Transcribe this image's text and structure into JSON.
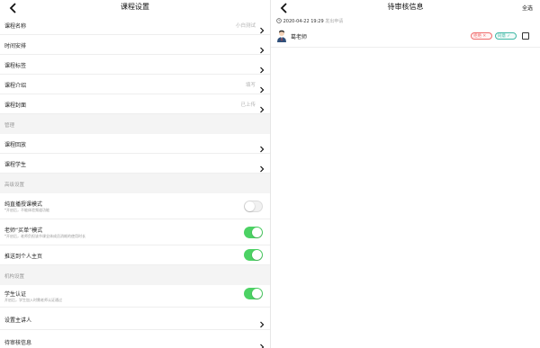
{
  "left": {
    "title": "课程设置",
    "rows_top": [
      {
        "label": "课程名称",
        "value": "小白测试"
      },
      {
        "label": "时间安排",
        "value": ""
      },
      {
        "label": "课程标签",
        "value": ""
      },
      {
        "label": "课程介绍",
        "value": "填写"
      },
      {
        "label": "课程封面",
        "value": "已上传"
      }
    ],
    "section_manage": "管理",
    "rows_manage": [
      {
        "label": "课程回放"
      },
      {
        "label": "课程学生"
      }
    ],
    "section_advanced": "高级设置",
    "toggles": [
      {
        "label": "纯直播授课模式",
        "sub": "*开启后，不能体验频道功能",
        "on": false
      },
      {
        "label": "老师“买单”模式",
        "sub": "*开启后，老师负担该节课全体成员消耗的使用时长",
        "on": true
      },
      {
        "label": "推送到个人主页",
        "sub": "",
        "on": true
      }
    ],
    "section_org": "机构设置",
    "org_toggle": {
      "label": "学生认证",
      "sub": "开启后，学生加入时需老师认证通过",
      "on": true
    },
    "rows_bottom": [
      {
        "label": "设置主讲人"
      },
      {
        "label": "待审核信息"
      }
    ]
  },
  "right": {
    "title": "待审核信息",
    "select_all": "全选",
    "request": {
      "date": "2020-04-22 19:29",
      "note": "发出申请",
      "name": "葛老师",
      "reject_label": "拒绝 ✕",
      "approve_label": "同意 ✓"
    }
  },
  "icons": {
    "back": "chevron-left-icon",
    "chevron": "chevron-right-icon",
    "clock": "clock-icon",
    "avatar": "teacher-avatar-icon"
  },
  "colors": {
    "toggle_on": "#4cd264",
    "reject": "#f06a6a",
    "approve": "#3fb8a5"
  }
}
